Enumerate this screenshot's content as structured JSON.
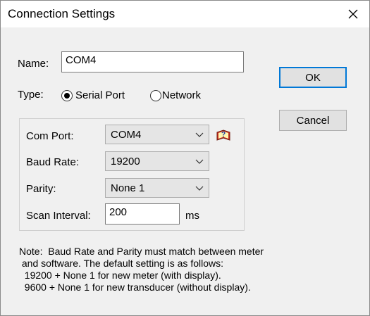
{
  "window": {
    "title": "Connection Settings",
    "close_symbol": "✕"
  },
  "form": {
    "name_label": "Name:",
    "name_value": "COM4",
    "type_label": "Type:",
    "type_options": [
      {
        "label": "Serial Port",
        "selected": true
      },
      {
        "label": "Network",
        "selected": false
      }
    ],
    "com_port_label": "Com Port:",
    "com_port_value": "COM4",
    "baud_rate_label": "Baud Rate:",
    "baud_rate_value": "19200",
    "parity_label": "Parity:",
    "parity_value": "None 1",
    "scan_interval_label": "Scan Interval:",
    "scan_interval_value": "200",
    "scan_interval_unit": "ms",
    "help_icon": "help-book-icon"
  },
  "buttons": {
    "ok": "OK",
    "cancel": "Cancel"
  },
  "note": {
    "lines": [
      "Note:  Baud Rate and Parity must match between meter",
      " and software. The default setting is as follows:",
      "  19200 + None 1 for new meter (with display).",
      "  9600 + None 1 for new transducer (without display)."
    ]
  },
  "colors": {
    "accent": "#0078d7",
    "dialog_bg": "#f0f0f0"
  }
}
